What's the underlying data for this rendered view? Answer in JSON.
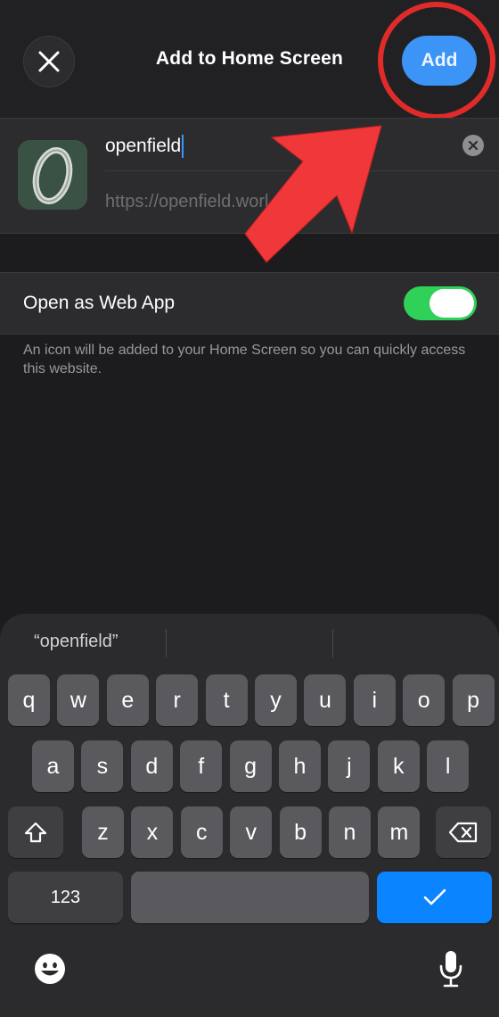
{
  "header": {
    "title": "Add to Home Screen",
    "add_label": "Add",
    "close_icon": "close-icon"
  },
  "bookmark": {
    "name_value": "openfield",
    "url_text": "https://openfield.worl",
    "icon_letter": "O",
    "icon_color": "#3a5244"
  },
  "web_app": {
    "label": "Open as Web App",
    "enabled": true,
    "note": "An icon will be added to your Home Screen so you can quickly access this website."
  },
  "keyboard": {
    "suggestion": "“openfield”",
    "row1": [
      "q",
      "w",
      "e",
      "r",
      "t",
      "y",
      "u",
      "i",
      "o",
      "p"
    ],
    "row2": [
      "a",
      "s",
      "d",
      "f",
      "g",
      "h",
      "j",
      "k",
      "l"
    ],
    "row3": [
      "z",
      "x",
      "c",
      "v",
      "b",
      "n",
      "m"
    ],
    "numbers_label": "123",
    "shift_icon": "shift-icon",
    "delete_icon": "backspace-icon",
    "done_icon": "checkmark-icon",
    "emoji_icon": "emoji-icon",
    "mic_icon": "microphone-icon"
  },
  "colors": {
    "accent": "#3c94f7",
    "toggle_on": "#30d158",
    "annotation_red": "#e12a2a"
  }
}
